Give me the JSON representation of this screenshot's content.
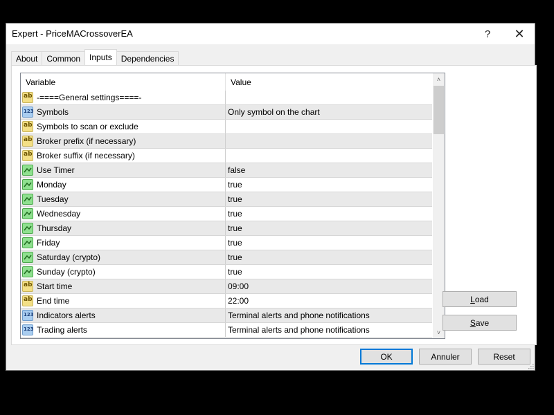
{
  "window": {
    "title": "Expert - PriceMACrossoverEA",
    "help_label": "?",
    "close_label": "✕"
  },
  "tabs": [
    {
      "label": "About",
      "active": false
    },
    {
      "label": "Common",
      "active": false
    },
    {
      "label": "Inputs",
      "active": true
    },
    {
      "label": "Dependencies",
      "active": false
    }
  ],
  "grid": {
    "columns": {
      "variable": "Variable",
      "value": "Value"
    },
    "rows": [
      {
        "type": "string",
        "variable": "-====General settings====-",
        "value": ""
      },
      {
        "type": "enum",
        "variable": "Symbols",
        "value": "Only symbol on the chart"
      },
      {
        "type": "string",
        "variable": "Symbols to scan or exclude",
        "value": ""
      },
      {
        "type": "string",
        "variable": "Broker prefix (if necessary)",
        "value": ""
      },
      {
        "type": "string",
        "variable": "Broker suffix (if necessary)",
        "value": ""
      },
      {
        "type": "bool",
        "variable": "Use Timer",
        "value": "false"
      },
      {
        "type": "bool",
        "variable": "Monday",
        "value": "true"
      },
      {
        "type": "bool",
        "variable": "Tuesday",
        "value": "true"
      },
      {
        "type": "bool",
        "variable": "Wednesday",
        "value": "true"
      },
      {
        "type": "bool",
        "variable": "Thursday",
        "value": "true"
      },
      {
        "type": "bool",
        "variable": "Friday",
        "value": "true"
      },
      {
        "type": "bool",
        "variable": "Saturday (crypto)",
        "value": "true"
      },
      {
        "type": "bool",
        "variable": "Sunday (crypto)",
        "value": "true"
      },
      {
        "type": "string",
        "variable": "Start time",
        "value": "09:00"
      },
      {
        "type": "string",
        "variable": "End time",
        "value": "22:00"
      },
      {
        "type": "enum",
        "variable": "Indicators alerts",
        "value": "Terminal alerts and phone notifications"
      },
      {
        "type": "enum",
        "variable": "Trading alerts",
        "value": "Terminal alerts and phone notifications"
      }
    ]
  },
  "buttons": {
    "load": {
      "mnemonic": "L",
      "rest": "oad"
    },
    "save": {
      "mnemonic": "S",
      "rest": "ave"
    },
    "ok": "OK",
    "cancel": "Annuler",
    "reset": "Reset"
  },
  "scrollbar": {
    "up_icon": "chevron-up",
    "down_icon": "chevron-down"
  }
}
